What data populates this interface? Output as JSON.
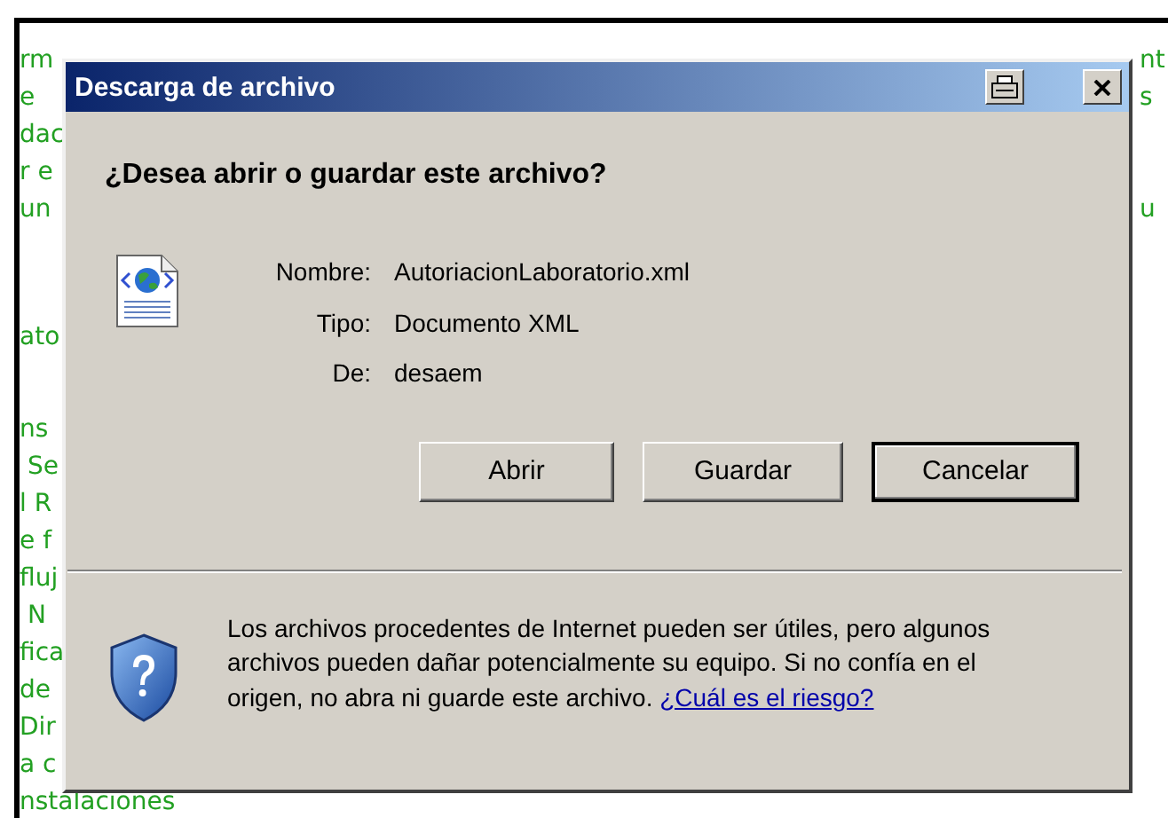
{
  "page": {
    "blocks": [
      {
        "lines": [
          {
            "left": "rm",
            "right": "nt"
          },
          {
            "left": "e",
            "right": "s"
          },
          {
            "left": "dac"
          },
          {
            "left": "r e"
          },
          {
            "left": "un",
            "right": "u"
          }
        ]
      },
      {
        "lines": [
          {
            "left": "ato"
          }
        ]
      },
      {
        "lines": [
          {
            "left": "ns"
          },
          {
            "left": " Se"
          },
          {
            "left": "l R"
          },
          {
            "left": "e f"
          },
          {
            "left": "fluj"
          },
          {
            "left": " N"
          },
          {
            "left": "fica"
          },
          {
            "left": "de"
          },
          {
            "left": "Dir"
          },
          {
            "left": "a c"
          },
          {
            "left": "nstalaciones"
          }
        ]
      }
    ]
  },
  "dialog": {
    "title": "Descarga de archivo",
    "title_buttons": [
      {
        "kind": "print"
      },
      {
        "kind": "close"
      }
    ],
    "heading": "¿Desea abrir o guardar este archivo?",
    "fields": [
      {
        "label": "Nombre:",
        "value": "AutoriacionLaboratorio.xml"
      },
      {
        "label": "Tipo:",
        "value": "Documento XML"
      },
      {
        "label": "De:",
        "value": "desaem"
      }
    ],
    "buttons": [
      {
        "label": "Abrir",
        "default": false
      },
      {
        "label": "Guardar",
        "default": false
      },
      {
        "label": "Cancelar",
        "default": true
      }
    ],
    "warning": {
      "text": "Los archivos procedentes de Internet pueden ser útiles, pero algunos archivos pueden dañar potencialmente su equipo. Si no confía en el origen, no abra ni guarde este archivo.",
      "link": "¿Cuál es el riesgo?"
    }
  }
}
